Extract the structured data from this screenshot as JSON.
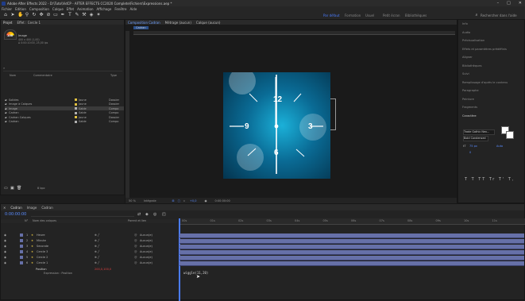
{
  "window": {
    "title": "Adobe After Effects 2022 - D:\\Tuto\\VidCP - AFTER EFFECTS CC2020 Complete\\Fichiers\\Expressions.aep *",
    "minimize": "–",
    "maximize": "□",
    "close": "✕"
  },
  "menu": [
    "Fichier",
    "Edition",
    "Composition",
    "Calque",
    "Effet",
    "Animation",
    "Affichage",
    "Fenêtre",
    "Aide"
  ],
  "toolbar": {
    "workspaces": [
      "Par défaut",
      "Formation",
      "Usuel",
      "Petit écran",
      "Bibliothèques"
    ],
    "search_placeholder": "Rechercher dans l'aide"
  },
  "project_panel": {
    "tabs": [
      "Projet",
      "Effet : Cercle 1"
    ],
    "item_name": "Image",
    "item_info": "400 x 400 (1,00)",
    "item_info2": "Δ 0:00:10:00, 25,00 ips",
    "search_placeholder": "",
    "columns": [
      "Nom",
      "Commentaire",
      "Type"
    ],
    "items": [
      {
        "name": "Solides",
        "color": "#e0c040",
        "label": "Jaune",
        "type": "Dossier"
      },
      {
        "name": "Image à Calques",
        "color": "#e0c040",
        "label": "Jaune",
        "type": "Dossier"
      },
      {
        "name": "Image",
        "color": "#b0b0b0",
        "label": "Sable",
        "type": "Compo"
      },
      {
        "name": "Cadran",
        "color": "#b0b0b0",
        "label": "Sable",
        "type": "Compo"
      },
      {
        "name": "Cadran Calques",
        "color": "#e0c040",
        "label": "Jaune",
        "type": "Dossier"
      },
      {
        "name": "Cadran",
        "color": "#b0b0b0",
        "label": "Sable",
        "type": "Compo"
      }
    ],
    "bpc": "8 bpc"
  },
  "comp_panel": {
    "tab_label": "Composition Cadran",
    "tab2": "Métrage (aucun)",
    "tab3": "Calque (aucun)",
    "breadcrumb": "Cadran",
    "zoom": "50 %",
    "resolution": "Intégrale",
    "timecode": "0:00:00:00",
    "exposure": "+0,0",
    "clock_numbers": [
      "12",
      "3",
      "6",
      "9"
    ]
  },
  "right_panel": {
    "items": [
      "Info",
      "Audio",
      "Prévisualisation",
      "Effets et paramètres prédéfinis",
      "Aligner",
      "Bibliothèques",
      "Suivi",
      "Remplissage d'après le contenu",
      "Paragraphe",
      "Peinture",
      "Fragments",
      "Caractère"
    ],
    "font": "Trade Gothic Nex...",
    "style": "Bold Condensed",
    "size": "75 px",
    "leading": "Auto",
    "tracking": "0"
  },
  "timeline": {
    "tabs": [
      "Cadran",
      "Image",
      "Cadran"
    ],
    "timecode": "0:00:00:00",
    "fps": "(25,00 ips)",
    "columns": [
      "N°",
      "Nom des calques",
      "Parent et lien"
    ],
    "layers": [
      {
        "num": "1",
        "name": "Heure",
        "parent": "Aucun(e)"
      },
      {
        "num": "2",
        "name": "Minute",
        "parent": "Aucun(e)"
      },
      {
        "num": "3",
        "name": "Seconde",
        "parent": "Aucun(e)"
      },
      {
        "num": "4",
        "name": "Cercle 3",
        "parent": "Aucun(e)"
      },
      {
        "num": "5",
        "name": "Cercle 2",
        "parent": "Aucun(e)"
      },
      {
        "num": "6",
        "name": "Cercle 1",
        "parent": "Aucun(e)"
      }
    ],
    "property": "Position",
    "property_value": "200,0,100,0",
    "expression_label": "Expression : Position",
    "expression_text": "wiggle(11,20)",
    "ruler": [
      "00s",
      "01s",
      "02s",
      "03s",
      "04s",
      "05s",
      "06s",
      "07s",
      "08s",
      "09s",
      "10s",
      "11s"
    ]
  }
}
